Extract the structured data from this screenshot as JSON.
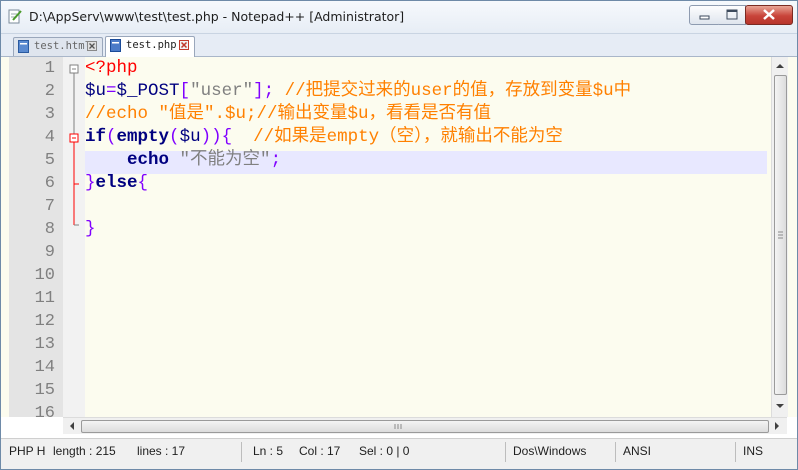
{
  "window": {
    "title": "D:\\AppServ\\www\\test\\test.php - Notepad++ [Administrator]"
  },
  "tabs": [
    {
      "label": "test.html",
      "active": false
    },
    {
      "label": "test.php",
      "active": true
    }
  ],
  "editor": {
    "line_numbers": [
      "1",
      "2",
      "3",
      "4",
      "5",
      "6",
      "7",
      "8",
      "9",
      "10",
      "11",
      "12",
      "13",
      "14",
      "15",
      "16"
    ],
    "current_line": 5,
    "code": {
      "l1_tag": "<?php",
      "l2_var": "$u",
      "l2_eq": "=",
      "l2_post": "$_POST",
      "l2_open": "[",
      "l2_str": "\"user\"",
      "l2_close": "];",
      "l2_comment": " //把提交过来的user的值，存放到变量$u中",
      "l3_comment": "//echo \"值是\".$u;//输出变量$u，看看是否有值",
      "l4_if": "if",
      "l4_open": "(",
      "l4_empty": "empty",
      "l4_open2": "(",
      "l4_var": "$u",
      "l4_close": ")){",
      "l4_comment": "  //如果是empty（空），就输出不能为空",
      "l5_indent": "    ",
      "l5_echo": "echo",
      "l5_space": " ",
      "l5_str": "\"不能为空\"",
      "l5_semi": ";",
      "l6_close": "}",
      "l6_else": "else",
      "l6_open": "{",
      "l8_close": "}"
    }
  },
  "status": {
    "language": "PHP H",
    "length": "length : 215",
    "lines": "lines : 17",
    "ln": "Ln : 5",
    "col": "Col : 17",
    "sel": "Sel : 0 | 0",
    "eol": "Dos\\Windows",
    "encoding": "ANSI",
    "mode": "INS"
  },
  "icons": {
    "app": "notepad-icon",
    "tab_file": "file-icon",
    "tab_close": "close-icon",
    "minimize": "minimize-icon",
    "maximize": "maximize-icon",
    "close": "close-icon"
  },
  "colors": {
    "keyword": "#000080",
    "string": "#808080",
    "operator": "#8000ff",
    "comment": "#ff8000",
    "php_tag": "#ff0000",
    "current_line": "#e8e8ff",
    "editor_bg": "#fcfcef"
  }
}
